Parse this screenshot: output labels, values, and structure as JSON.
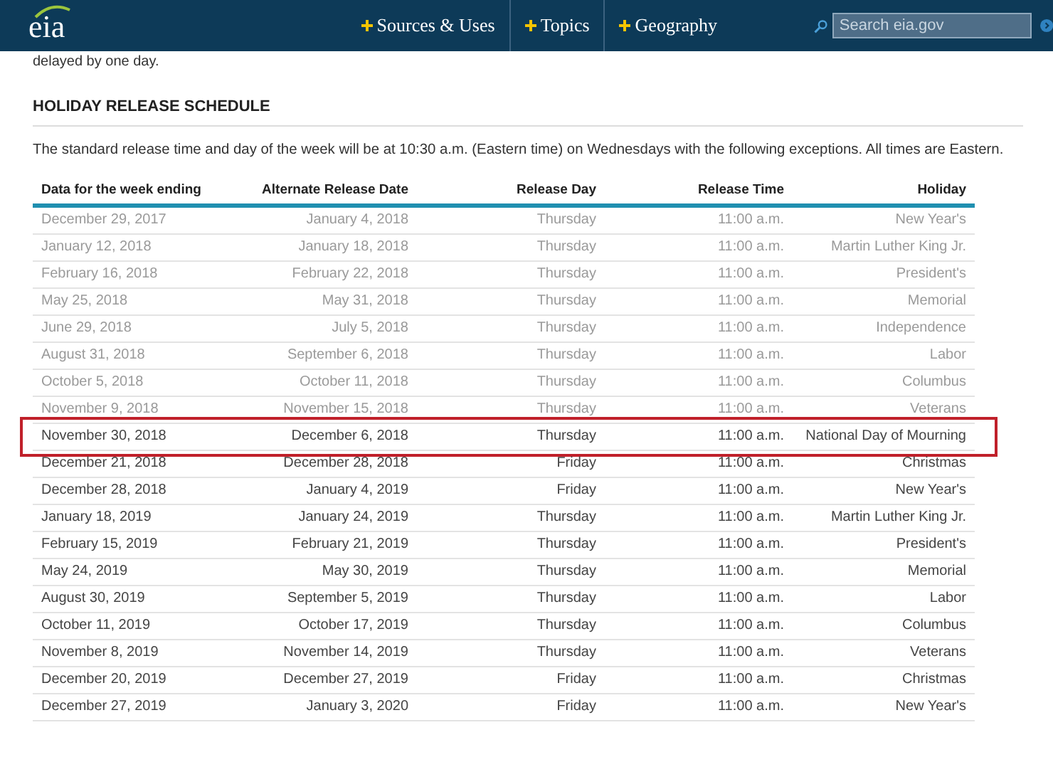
{
  "header": {
    "logo": "eia",
    "nav": [
      {
        "label": "Sources & Uses"
      },
      {
        "label": "Topics"
      },
      {
        "label": "Geography"
      }
    ],
    "search": {
      "placeholder": "Search eia.gov"
    }
  },
  "intro_tail": "delayed by one day.",
  "section": {
    "title": "HOLIDAY RELEASE SCHEDULE",
    "description": "The standard release time and day of the week will be at 10:30 a.m. (Eastern time) on Wednesdays with the following exceptions. All times are Eastern."
  },
  "table": {
    "columns": [
      "Data for the week ending",
      "Alternate Release Date",
      "Release Day",
      "Release Time",
      "Holiday"
    ],
    "rows": [
      {
        "cells": [
          "December 29, 2017",
          "January 4, 2018",
          "Thursday",
          "11:00 a.m.",
          "New Year's"
        ],
        "past": true,
        "highlighted": false
      },
      {
        "cells": [
          "January 12, 2018",
          "January 18, 2018",
          "Thursday",
          "11:00 a.m.",
          "Martin Luther King Jr."
        ],
        "past": true,
        "highlighted": false
      },
      {
        "cells": [
          "February 16, 2018",
          "February 22, 2018",
          "Thursday",
          "11:00 a.m.",
          "President's"
        ],
        "past": true,
        "highlighted": false
      },
      {
        "cells": [
          "May 25, 2018",
          "May 31, 2018",
          "Thursday",
          "11:00 a.m.",
          "Memorial"
        ],
        "past": true,
        "highlighted": false
      },
      {
        "cells": [
          "June 29, 2018",
          "July 5, 2018",
          "Thursday",
          "11:00 a.m.",
          "Independence"
        ],
        "past": true,
        "highlighted": false
      },
      {
        "cells": [
          "August 31, 2018",
          "September 6, 2018",
          "Thursday",
          "11:00 a.m.",
          "Labor"
        ],
        "past": true,
        "highlighted": false
      },
      {
        "cells": [
          "October 5, 2018",
          "October 11, 2018",
          "Thursday",
          "11:00 a.m.",
          "Columbus"
        ],
        "past": true,
        "highlighted": false
      },
      {
        "cells": [
          "November 9, 2018",
          "November 15, 2018",
          "Thursday",
          "11:00 a.m.",
          "Veterans"
        ],
        "past": true,
        "highlighted": false
      },
      {
        "cells": [
          "November 30, 2018",
          "December 6, 2018",
          "Thursday",
          "11:00 a.m.",
          "National Day of Mourning"
        ],
        "past": false,
        "highlighted": true
      },
      {
        "cells": [
          "December 21, 2018",
          "December 28, 2018",
          "Friday",
          "11:00 a.m.",
          "Christmas"
        ],
        "past": false,
        "highlighted": false
      },
      {
        "cells": [
          "December 28, 2018",
          "January 4, 2019",
          "Friday",
          "11:00 a.m.",
          "New Year's"
        ],
        "past": false,
        "highlighted": false
      },
      {
        "cells": [
          "January 18, 2019",
          "January 24, 2019",
          "Thursday",
          "11:00 a.m.",
          "Martin Luther King Jr."
        ],
        "past": false,
        "highlighted": false
      },
      {
        "cells": [
          "February 15, 2019",
          "February 21, 2019",
          "Thursday",
          "11:00 a.m.",
          "President's"
        ],
        "past": false,
        "highlighted": false
      },
      {
        "cells": [
          "May 24, 2019",
          "May 30, 2019",
          "Thursday",
          "11:00 a.m.",
          "Memorial"
        ],
        "past": false,
        "highlighted": false
      },
      {
        "cells": [
          "August 30, 2019",
          "September 5, 2019",
          "Thursday",
          "11:00 a.m.",
          "Labor"
        ],
        "past": false,
        "highlighted": false
      },
      {
        "cells": [
          "October 11, 2019",
          "October 17, 2019",
          "Thursday",
          "11:00 a.m.",
          "Columbus"
        ],
        "past": false,
        "highlighted": false
      },
      {
        "cells": [
          "November 8, 2019",
          "November 14, 2019",
          "Thursday",
          "11:00 a.m.",
          "Veterans"
        ],
        "past": false,
        "highlighted": false
      },
      {
        "cells": [
          "December 20, 2019",
          "December 27, 2019",
          "Friday",
          "11:00 a.m.",
          "Christmas"
        ],
        "past": false,
        "highlighted": false
      },
      {
        "cells": [
          "December 27, 2019",
          "January 3, 2020",
          "Friday",
          "11:00 a.m.",
          "New Year's"
        ],
        "past": false,
        "highlighted": false
      }
    ]
  }
}
